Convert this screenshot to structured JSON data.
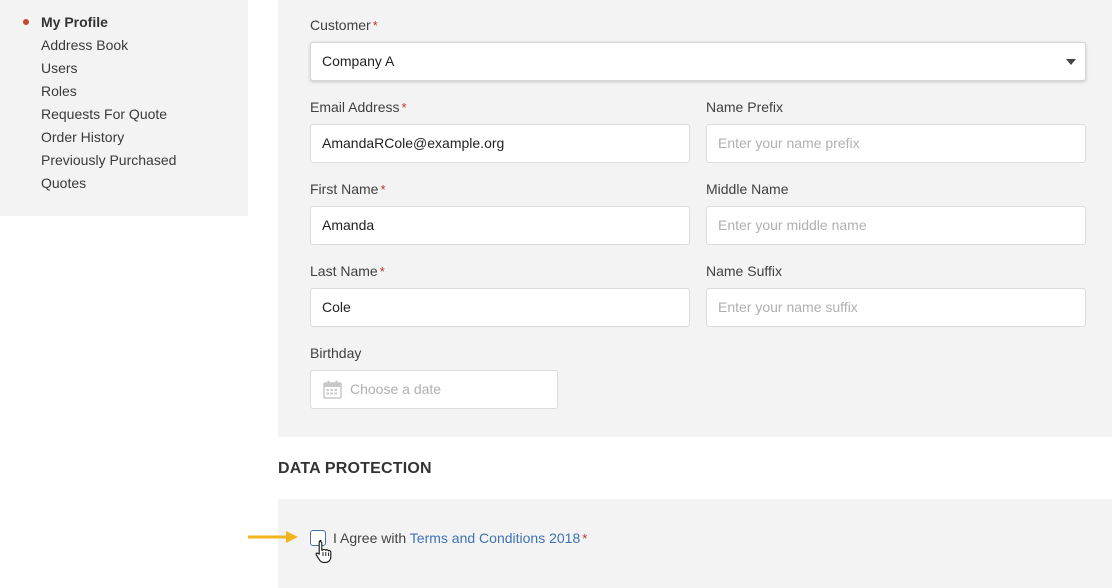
{
  "sidebar": {
    "items": [
      {
        "label": "My Profile",
        "active": true
      },
      {
        "label": "Address Book"
      },
      {
        "label": "Users"
      },
      {
        "label": "Roles"
      },
      {
        "label": "Requests For Quote"
      },
      {
        "label": "Order History"
      },
      {
        "label": "Previously Purchased"
      },
      {
        "label": "Quotes"
      }
    ]
  },
  "form": {
    "customer": {
      "label": "Customer",
      "value": "Company A"
    },
    "email": {
      "label": "Email Address",
      "value": "AmandaRCole@example.org"
    },
    "name_prefix": {
      "label": "Name Prefix",
      "placeholder": "Enter your name prefix"
    },
    "first_name": {
      "label": "First Name",
      "value": "Amanda"
    },
    "middle_name": {
      "label": "Middle Name",
      "placeholder": "Enter your middle name"
    },
    "last_name": {
      "label": "Last Name",
      "value": "Cole"
    },
    "name_suffix": {
      "label": "Name Suffix",
      "placeholder": "Enter your name suffix"
    },
    "birthday": {
      "label": "Birthday",
      "placeholder": "Choose a date"
    },
    "required_mark": "*"
  },
  "data_protection": {
    "title": "DATA PROTECTION",
    "agree_prefix": "I Agree with",
    "terms_link": "Terms and Conditions 2018",
    "required_mark": "*"
  },
  "colors": {
    "accent_bullet": "#c24b2e",
    "link": "#3f73b5",
    "arrow": "#f2b41c",
    "required": "#b33a2a"
  },
  "icons": {
    "select_caret": "chevron-down-icon",
    "birthday": "calendar-icon",
    "pointer": "hand-cursor-icon",
    "annotation": "arrow-right-icon"
  }
}
